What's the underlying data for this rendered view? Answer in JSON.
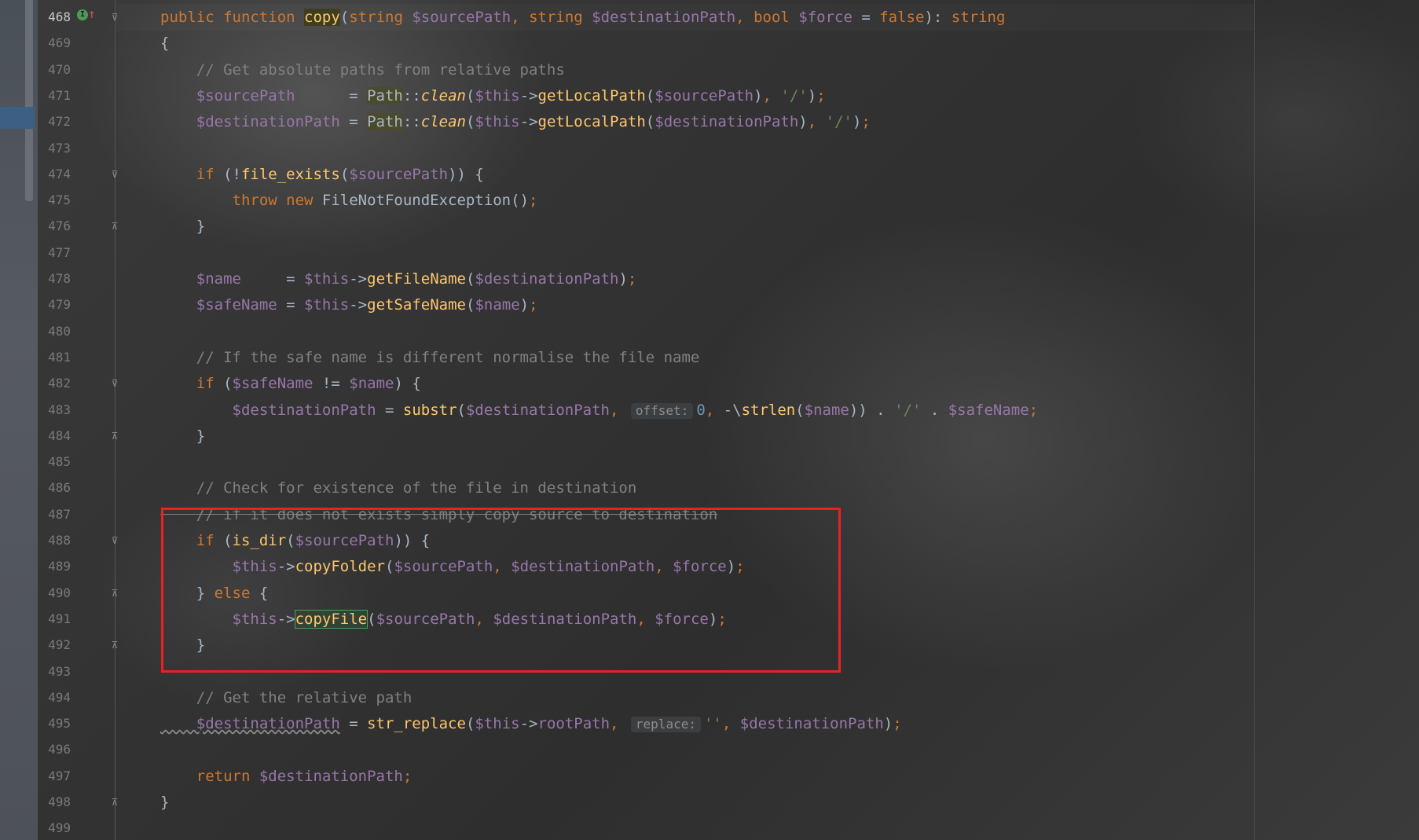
{
  "editor": {
    "colors": {
      "keyword": "#cc7832",
      "variable": "#9876aa",
      "function": "#ffc66d",
      "string": "#6a8759",
      "comment": "#808080",
      "number": "#6897bb",
      "highlight_box": "#e8231f"
    },
    "gutter": {
      "override_icon": "implements-method-icon",
      "override_icon_label": "I",
      "arrow": "↑",
      "fold_open": "⊽",
      "fold_close": "⊼"
    },
    "lines": [
      {
        "no": "468",
        "tokens": [
          [
            "kw",
            "public "
          ],
          [
            "kw",
            "function "
          ],
          [
            "fn hl-copy",
            "copy"
          ],
          [
            "cls",
            "("
          ],
          [
            "kw",
            "string "
          ],
          [
            "var",
            "$sourcePath"
          ],
          [
            "kw",
            ", "
          ],
          [
            "kw",
            "string "
          ],
          [
            "var",
            "$destinationPath"
          ],
          [
            "kw",
            ", "
          ],
          [
            "kw",
            "bool "
          ],
          [
            "var",
            "$force"
          ],
          [
            "cls",
            " = "
          ],
          [
            "kw",
            "false"
          ],
          [
            "cls",
            "): "
          ],
          [
            "kw",
            "string"
          ]
        ]
      },
      {
        "no": "469",
        "tokens": [
          [
            "cls",
            "{"
          ]
        ]
      },
      {
        "no": "470",
        "tokens": [
          [
            "cm",
            "    // Get absolute paths from relative paths"
          ]
        ]
      },
      {
        "no": "471",
        "tokens": [
          [
            "var",
            "    $sourcePath"
          ],
          [
            "cls",
            "      = "
          ],
          [
            "cls hl-path",
            "Path"
          ],
          [
            "cls",
            "::"
          ],
          [
            "static",
            "clean"
          ],
          [
            "cls",
            "("
          ],
          [
            "var",
            "$this"
          ],
          [
            "cls",
            "->"
          ],
          [
            "fn",
            "getLocalPath"
          ],
          [
            "cls",
            "("
          ],
          [
            "var",
            "$sourcePath"
          ],
          [
            "cls",
            ")"
          ],
          [
            "kw",
            ", "
          ],
          [
            "str",
            "'/'"
          ],
          [
            "cls",
            ")"
          ],
          [
            "kw",
            ";"
          ]
        ]
      },
      {
        "no": "472",
        "tokens": [
          [
            "var",
            "    $destinationPath"
          ],
          [
            "cls",
            " = "
          ],
          [
            "cls hl-path",
            "Path"
          ],
          [
            "cls",
            "::"
          ],
          [
            "static",
            "clean"
          ],
          [
            "cls",
            "("
          ],
          [
            "var",
            "$this"
          ],
          [
            "cls",
            "->"
          ],
          [
            "fn",
            "getLocalPath"
          ],
          [
            "cls",
            "("
          ],
          [
            "var",
            "$destinationPath"
          ],
          [
            "cls",
            ")"
          ],
          [
            "kw",
            ", "
          ],
          [
            "str",
            "'/'"
          ],
          [
            "cls",
            ")"
          ],
          [
            "kw",
            ";"
          ]
        ]
      },
      {
        "no": "473",
        "tokens": []
      },
      {
        "no": "474",
        "tokens": [
          [
            "kw",
            "    if "
          ],
          [
            "cls",
            "(!"
          ],
          [
            "fn",
            "file_exists"
          ],
          [
            "cls",
            "("
          ],
          [
            "var",
            "$sourcePath"
          ],
          [
            "cls",
            ")) {"
          ]
        ]
      },
      {
        "no": "475",
        "tokens": [
          [
            "kw",
            "        throw new "
          ],
          [
            "cls",
            "FileNotFoundException()"
          ],
          [
            "kw",
            ";"
          ]
        ]
      },
      {
        "no": "476",
        "tokens": [
          [
            "cls",
            "    }"
          ]
        ]
      },
      {
        "no": "477",
        "tokens": []
      },
      {
        "no": "478",
        "tokens": [
          [
            "var",
            "    $name"
          ],
          [
            "cls",
            "     = "
          ],
          [
            "var",
            "$this"
          ],
          [
            "cls",
            "->"
          ],
          [
            "fn",
            "getFileName"
          ],
          [
            "cls",
            "("
          ],
          [
            "var",
            "$destinationPath"
          ],
          [
            "cls",
            ")"
          ],
          [
            "kw",
            ";"
          ]
        ]
      },
      {
        "no": "479",
        "tokens": [
          [
            "var",
            "    $safeName"
          ],
          [
            "cls",
            " = "
          ],
          [
            "var",
            "$this"
          ],
          [
            "cls",
            "->"
          ],
          [
            "fn",
            "getSafeName"
          ],
          [
            "cls",
            "("
          ],
          [
            "var",
            "$name"
          ],
          [
            "cls",
            ")"
          ],
          [
            "kw",
            ";"
          ]
        ]
      },
      {
        "no": "480",
        "tokens": []
      },
      {
        "no": "481",
        "tokens": [
          [
            "cm",
            "    // If the safe name is different normalise the file name"
          ]
        ]
      },
      {
        "no": "482",
        "tokens": [
          [
            "kw",
            "    if "
          ],
          [
            "cls",
            "("
          ],
          [
            "var",
            "$safeName"
          ],
          [
            "cls",
            " != "
          ],
          [
            "var",
            "$name"
          ],
          [
            "cls",
            ") {"
          ]
        ]
      },
      {
        "no": "483",
        "tokens": [
          [
            "var",
            "        $destinationPath"
          ],
          [
            "cls",
            " = "
          ],
          [
            "fn",
            "substr"
          ],
          [
            "cls",
            "("
          ],
          [
            "var",
            "$destinationPath"
          ],
          [
            "kw",
            ", "
          ],
          [
            "hint",
            "offset:"
          ],
          [
            "num",
            "0"
          ],
          [
            "kw",
            ", "
          ],
          [
            "cls",
            "-\\"
          ],
          [
            "fn",
            "strlen"
          ],
          [
            "cls",
            "("
          ],
          [
            "var",
            "$name"
          ],
          [
            "cls",
            ")) . "
          ],
          [
            "str",
            "'/'"
          ],
          [
            "cls",
            " . "
          ],
          [
            "var",
            "$safeName"
          ],
          [
            "kw",
            ";"
          ]
        ]
      },
      {
        "no": "484",
        "tokens": [
          [
            "cls",
            "    }"
          ]
        ]
      },
      {
        "no": "485",
        "tokens": []
      },
      {
        "no": "486",
        "tokens": [
          [
            "cm",
            "    // Check for existence of the file in destination"
          ]
        ]
      },
      {
        "no": "487",
        "tokens": [
          [
            "cm struck",
            "    // if it does not exists simply copy source to destination"
          ]
        ]
      },
      {
        "no": "488",
        "tokens": [
          [
            "kw",
            "    if "
          ],
          [
            "cls",
            "("
          ],
          [
            "fn",
            "is_dir"
          ],
          [
            "cls",
            "("
          ],
          [
            "var",
            "$sourcePath"
          ],
          [
            "cls",
            ")) {"
          ]
        ]
      },
      {
        "no": "489",
        "tokens": [
          [
            "var",
            "        $this"
          ],
          [
            "cls",
            "->"
          ],
          [
            "fn",
            "copyFolder"
          ],
          [
            "cls",
            "("
          ],
          [
            "var",
            "$sourcePath"
          ],
          [
            "kw",
            ", "
          ],
          [
            "var",
            "$destinationPath"
          ],
          [
            "kw",
            ", "
          ],
          [
            "var",
            "$force"
          ],
          [
            "cls",
            ")"
          ],
          [
            "kw",
            ";"
          ]
        ]
      },
      {
        "no": "490",
        "tokens": [
          [
            "cls",
            "    } "
          ],
          [
            "kw",
            "else "
          ],
          [
            "cls",
            "{"
          ]
        ]
      },
      {
        "no": "491",
        "tokens": [
          [
            "var",
            "        $this"
          ],
          [
            "cls",
            "->"
          ],
          [
            "fn hl-copyfile",
            "copyFile"
          ],
          [
            "cls",
            "("
          ],
          [
            "var",
            "$sourcePath"
          ],
          [
            "kw",
            ", "
          ],
          [
            "var",
            "$destinationPath"
          ],
          [
            "kw",
            ", "
          ],
          [
            "var",
            "$force"
          ],
          [
            "cls",
            ")"
          ],
          [
            "kw",
            ";"
          ]
        ]
      },
      {
        "no": "492",
        "tokens": [
          [
            "cls",
            "    }"
          ]
        ]
      },
      {
        "no": "493",
        "tokens": []
      },
      {
        "no": "494",
        "tokens": [
          [
            "cm",
            "    // Get the relative path"
          ]
        ]
      },
      {
        "no": "495",
        "tokens": [
          [
            "var squiggle",
            "    $destinationPath"
          ],
          [
            "cls",
            " = "
          ],
          [
            "fn",
            "str_replace"
          ],
          [
            "cls",
            "("
          ],
          [
            "var",
            "$this"
          ],
          [
            "cls",
            "->"
          ],
          [
            "var",
            "rootPath"
          ],
          [
            "kw",
            ", "
          ],
          [
            "hint",
            "replace:"
          ],
          [
            "str",
            "''"
          ],
          [
            "kw",
            ", "
          ],
          [
            "var",
            "$destinationPath"
          ],
          [
            "cls",
            ")"
          ],
          [
            "kw",
            ";"
          ]
        ]
      },
      {
        "no": "496",
        "tokens": []
      },
      {
        "no": "497",
        "tokens": [
          [
            "kw",
            "    return "
          ],
          [
            "var",
            "$destinationPath"
          ],
          [
            "kw",
            ";"
          ]
        ]
      },
      {
        "no": "498",
        "tokens": [
          [
            "cls",
            "}"
          ]
        ]
      },
      {
        "no": "499",
        "tokens": []
      }
    ]
  }
}
